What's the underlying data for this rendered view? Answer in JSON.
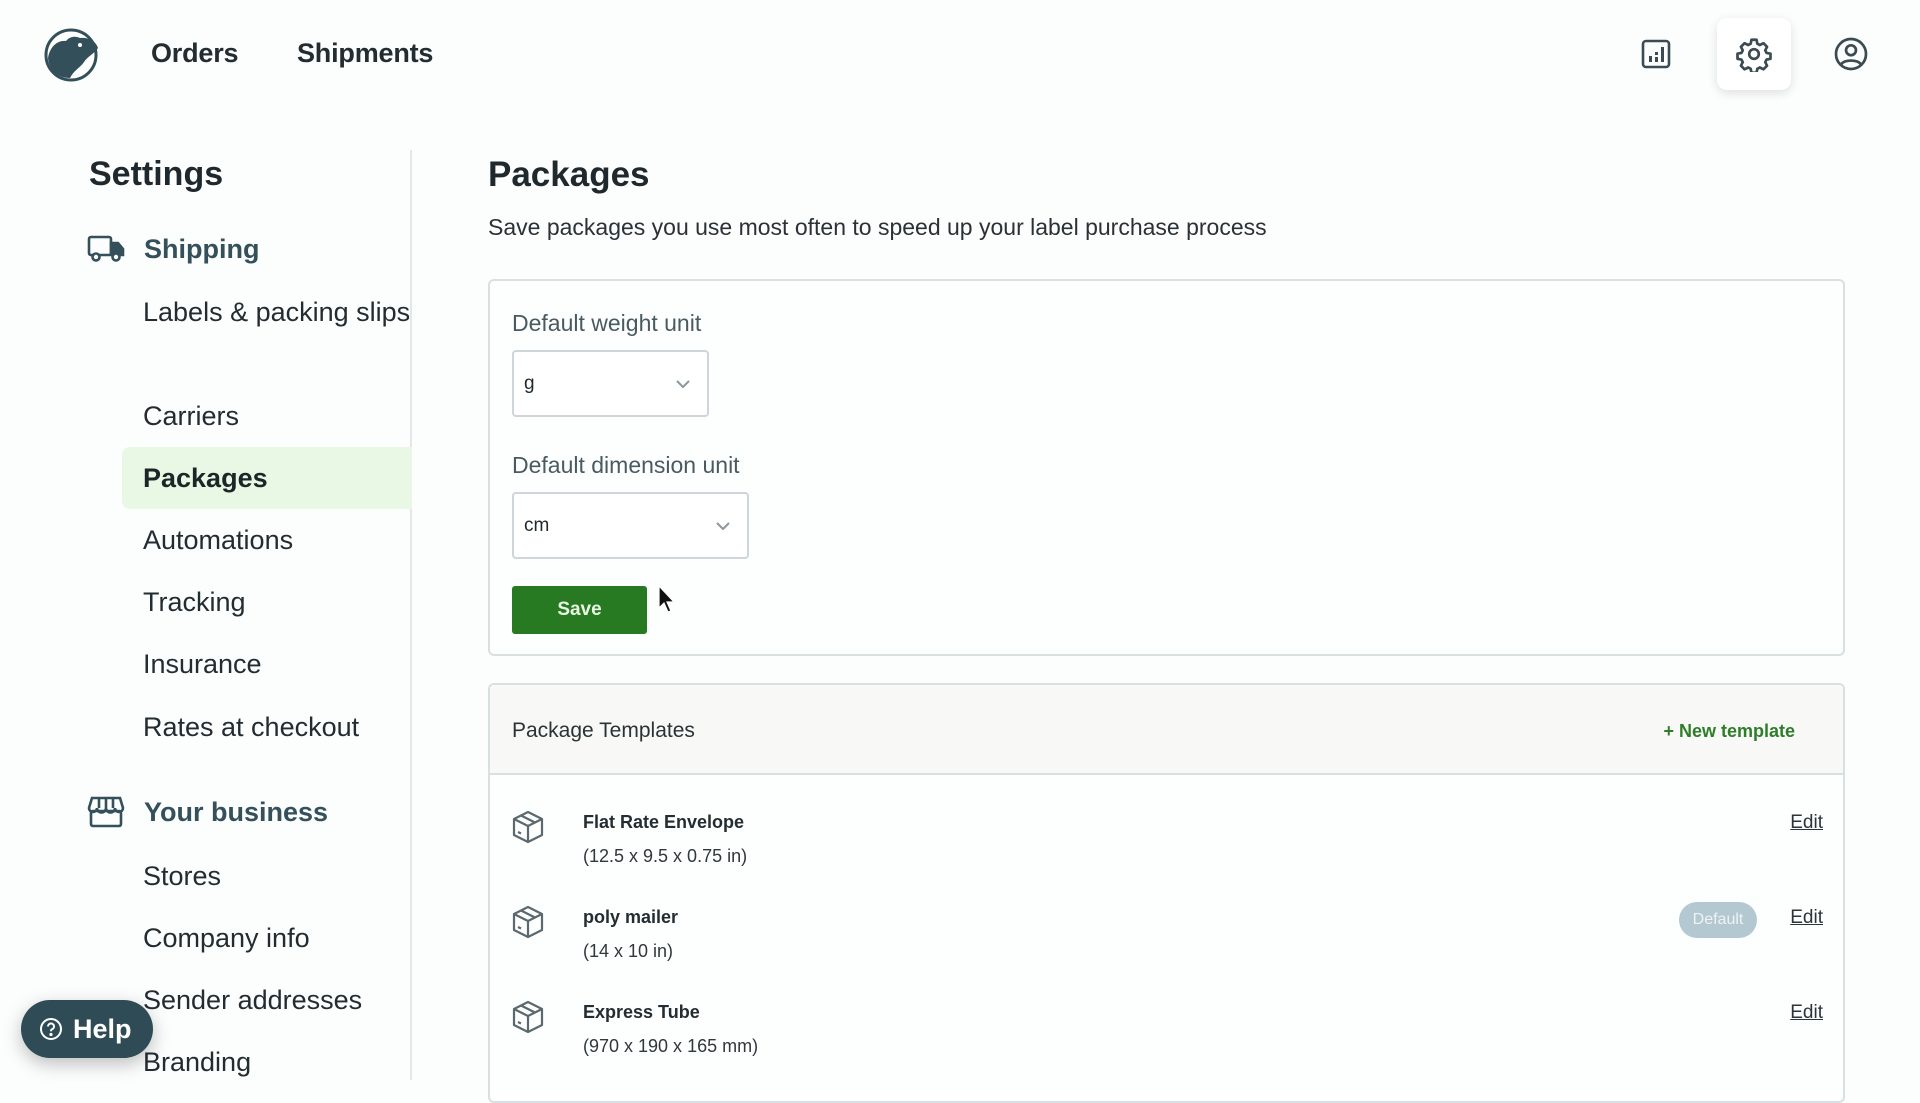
{
  "topnav": {
    "logo": "capybara-logo",
    "links": [
      {
        "label": "Orders"
      },
      {
        "label": "Shipments"
      }
    ],
    "icons": [
      {
        "name": "reports-icon",
        "active": false
      },
      {
        "name": "settings-gear-icon",
        "active": true
      },
      {
        "name": "account-icon",
        "active": false
      }
    ]
  },
  "sidebar": {
    "title": "Settings",
    "sections": [
      {
        "label": "Shipping",
        "icon": "truck-icon",
        "items": [
          {
            "label": "Labels & packing slips"
          },
          {
            "label": "Carriers"
          },
          {
            "label": "Packages",
            "active": true
          },
          {
            "label": "Automations"
          },
          {
            "label": "Tracking"
          },
          {
            "label": "Insurance"
          },
          {
            "label": "Rates at checkout"
          }
        ]
      },
      {
        "label": "Your business",
        "icon": "storefront-icon",
        "items": [
          {
            "label": "Stores"
          },
          {
            "label": "Company info"
          },
          {
            "label": "Sender addresses"
          },
          {
            "label": "Branding"
          }
        ]
      }
    ]
  },
  "main": {
    "title": "Packages",
    "subtitle": "Save packages you use most often to speed up your label purchase process",
    "units": {
      "weight_label": "Default weight unit",
      "weight_value": "g",
      "dimension_label": "Default dimension unit",
      "dimension_value": "cm",
      "save_label": "Save"
    },
    "templates": {
      "title": "Package Templates",
      "new_label": "+ New template",
      "edit_label": "Edit",
      "default_badge": "Default",
      "items": [
        {
          "name": "Flat Rate Envelope",
          "dims": "(12.5 x 9.5 x 0.75 in)",
          "is_default": false
        },
        {
          "name": "poly mailer",
          "dims": "(14 x 10 in)",
          "is_default": true
        },
        {
          "name": "Express Tube",
          "dims": "(970 x 190 x 165 mm)",
          "is_default": false
        }
      ]
    }
  },
  "help": {
    "label": "Help"
  },
  "colors": {
    "brand_dark": "#2f4c56",
    "primary_green": "#277a22",
    "active_nav_bg": "#e9f8e4",
    "default_badge_bg": "#b3c8d0"
  }
}
